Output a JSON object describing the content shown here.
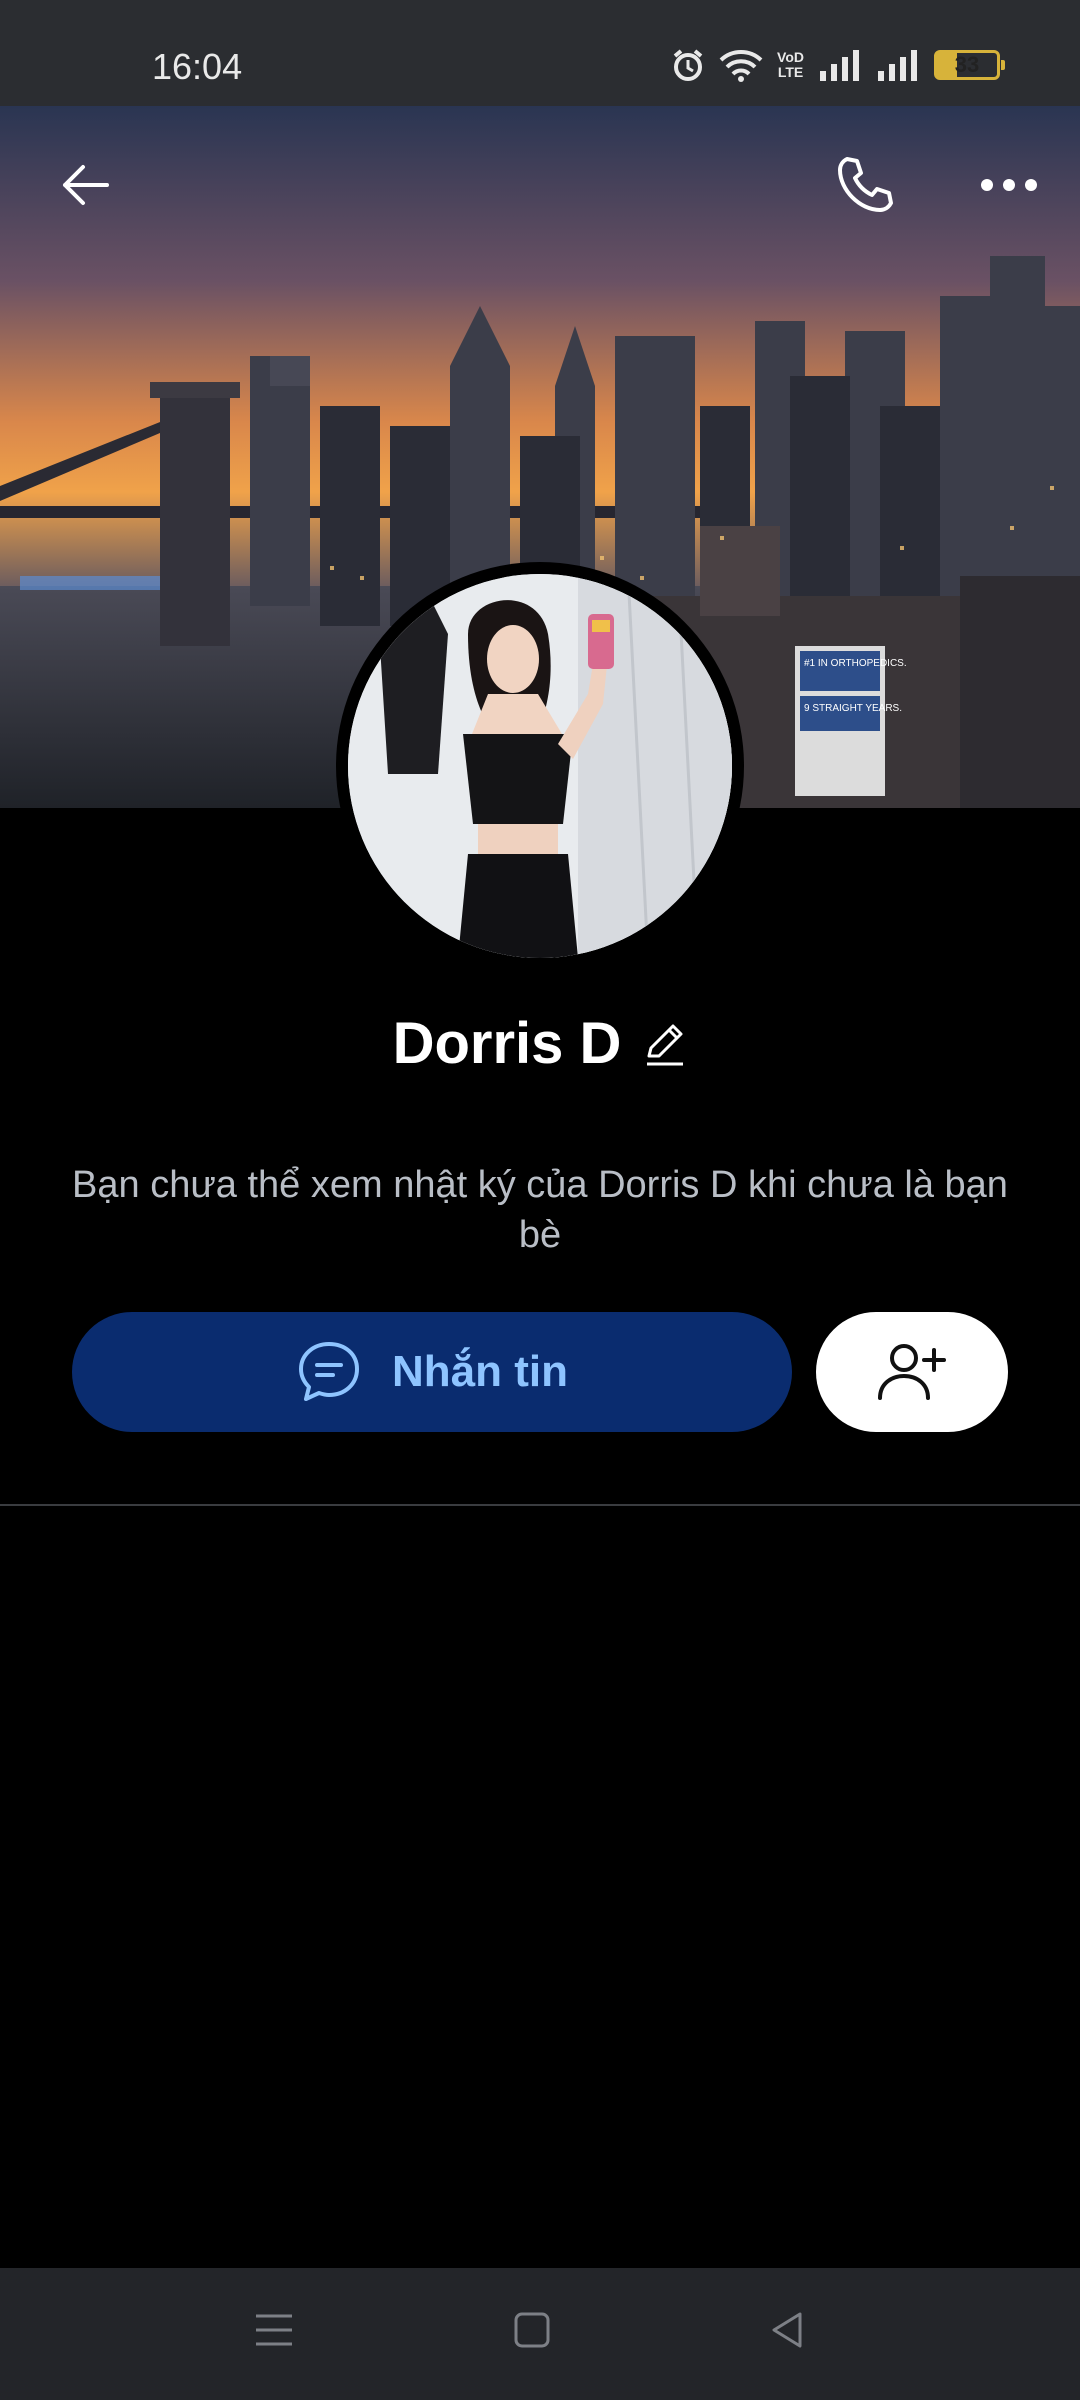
{
  "status_bar": {
    "time": "16:04",
    "battery": "33",
    "network_labels": [
      "VoD",
      "LTE"
    ]
  },
  "profile": {
    "name": "Dorris D",
    "notice": "Bạn chưa thể xem nhật ký của Dorris D khi chưa là bạn bè",
    "message_button_label": "Nhắn tin"
  },
  "cover_sign_text": [
    "#1 IN ORTHOPEDICS.",
    "9 STRAIGHT YEARS."
  ],
  "icons": {
    "back": "arrow-left-icon",
    "call": "phone-icon",
    "more": "more-dots-icon",
    "edit": "pencil-icon",
    "chat": "chat-bubble-icon",
    "add_friend": "add-friend-icon"
  },
  "colors": {
    "message_button_bg": "#0a2c6f",
    "message_button_text": "#8ec4ff",
    "background": "#000000"
  }
}
